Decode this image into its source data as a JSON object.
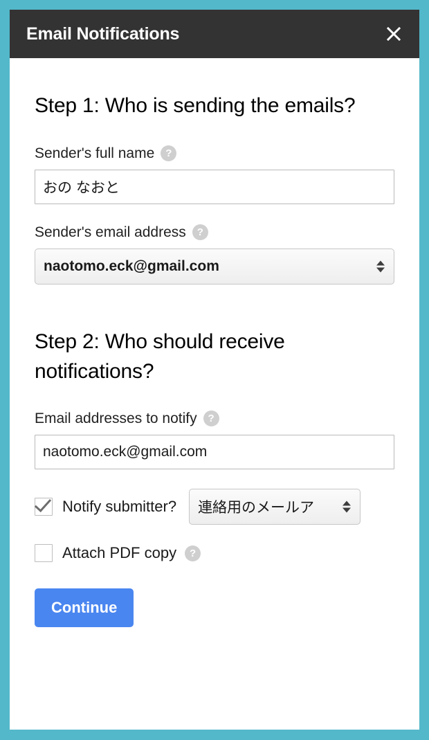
{
  "window": {
    "title": "Email Notifications",
    "close_icon": "close-icon",
    "accent_border_color": "#53b8ca",
    "titlebar_color": "#333333"
  },
  "step1": {
    "heading": "Step 1: Who is sending the emails?",
    "sender_name": {
      "label": "Sender's full name",
      "help_icon": "help-icon",
      "value": "おの なおと"
    },
    "sender_email": {
      "label": "Sender's email address",
      "help_icon": "help-icon",
      "selected": "naotomo.eck@gmail.com",
      "stepper_icon": "stepper-arrows-icon"
    }
  },
  "step2": {
    "heading": "Step 2: Who should receive notifications?",
    "notify_addresses": {
      "label": "Email addresses to notify",
      "help_icon": "help-icon",
      "value": "naotomo.eck@gmail.com"
    },
    "notify_submitter": {
      "label": "Notify submitter?",
      "checked": true,
      "field_selected": "連絡用のメールア",
      "stepper_icon": "stepper-arrows-icon"
    },
    "attach_pdf": {
      "label": "Attach PDF copy",
      "checked": false,
      "help_icon": "help-icon"
    }
  },
  "actions": {
    "continue_label": "Continue",
    "continue_color": "#4a86f0"
  }
}
